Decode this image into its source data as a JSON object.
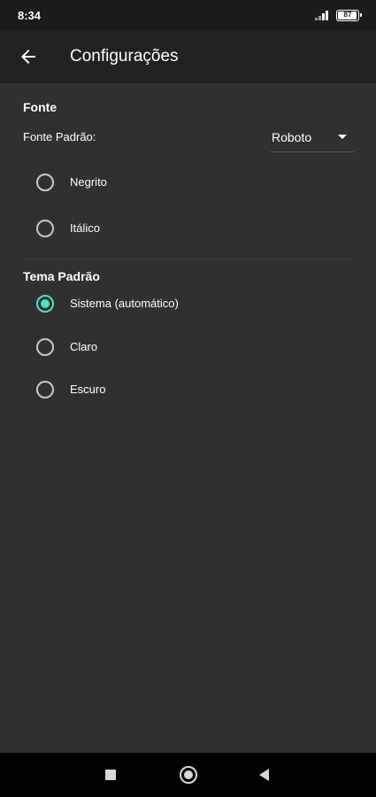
{
  "status_bar": {
    "time": "8:34",
    "battery": "87"
  },
  "app_bar": {
    "title": "Configurações",
    "back_icon": "arrow-back-icon"
  },
  "font_section": {
    "header": "Fonte",
    "default_font_label": "Fonte Padrão:",
    "default_font_value": "Roboto",
    "options": [
      {
        "label": "Negrito",
        "checked": false
      },
      {
        "label": "Itálico",
        "checked": false
      }
    ]
  },
  "theme_section": {
    "header": "Tema Padrão",
    "options": [
      {
        "label": "Sistema (automático)",
        "checked": true
      },
      {
        "label": "Claro",
        "checked": false
      },
      {
        "label": "Escuro",
        "checked": false
      }
    ]
  },
  "colors": {
    "accent": "#4fe3c1",
    "background": "#303030",
    "app_bar": "#212121"
  },
  "nav_bar": {
    "icons": [
      "recents-square-icon",
      "home-circle-icon",
      "back-triangle-icon"
    ]
  }
}
